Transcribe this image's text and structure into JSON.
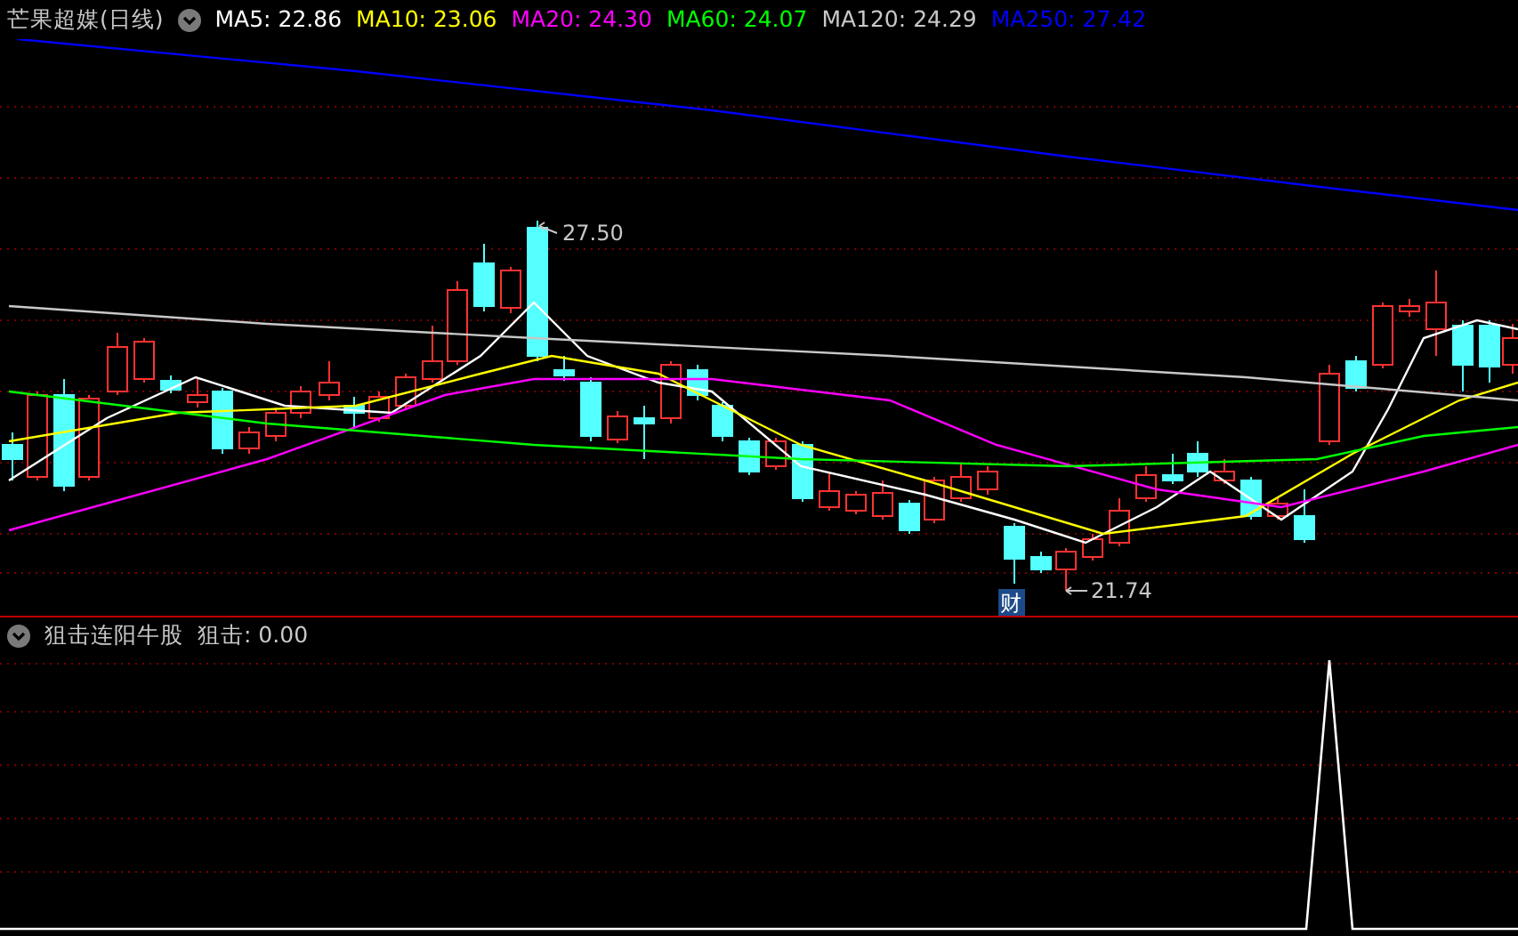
{
  "main_chart": {
    "title": "芒果超媒(日线)",
    "legend": [
      {
        "label": "MA5: 22.86",
        "color": "#ffffff"
      },
      {
        "label": "MA10: 23.06",
        "color": "#ffff00"
      },
      {
        "label": "MA20: 24.30",
        "color": "#ff00ff"
      },
      {
        "label": "MA60: 24.07",
        "color": "#00ff00"
      },
      {
        "label": "MA120: 24.29",
        "color": "#c8c8c8"
      },
      {
        "label": "MA250: 27.42",
        "color": "#0000ff"
      }
    ],
    "high_label": "27.50",
    "low_label": "21.74",
    "badge": "财"
  },
  "indicator_panel": {
    "title": "狙击连阳牛股",
    "reading": "狙击: 0.00"
  }
}
